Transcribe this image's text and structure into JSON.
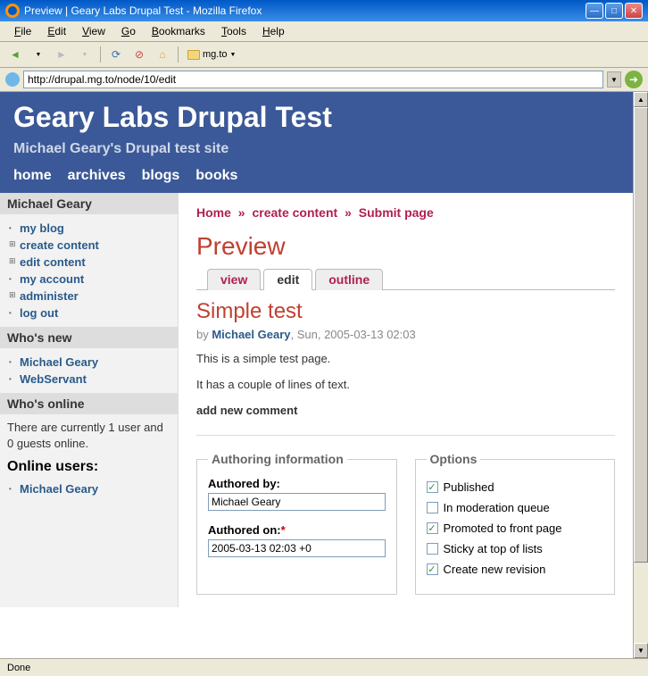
{
  "window": {
    "title": "Preview | Geary Labs Drupal Test - Mozilla Firefox"
  },
  "menubar": [
    "File",
    "Edit",
    "View",
    "Go",
    "Bookmarks",
    "Tools",
    "Help"
  ],
  "toolbar": {
    "bookmark": "mg.to"
  },
  "addressbar": {
    "url": "http://drupal.mg.to/node/10/edit"
  },
  "site": {
    "title": "Geary Labs Drupal Test",
    "tagline": "Michael Geary's Drupal test site",
    "nav": [
      "home",
      "archives",
      "blogs",
      "books"
    ]
  },
  "sidebar": {
    "user_block_title": "Michael Geary",
    "user_menu": [
      {
        "label": "my blog",
        "type": "leaf"
      },
      {
        "label": "create content",
        "type": "collapsed"
      },
      {
        "label": "edit content",
        "type": "collapsed"
      },
      {
        "label": "my account",
        "type": "leaf"
      },
      {
        "label": "administer",
        "type": "collapsed"
      },
      {
        "label": "log out",
        "type": "leaf"
      }
    ],
    "whos_new_title": "Who's new",
    "whos_new": [
      "Michael Geary",
      "WebServant"
    ],
    "whos_online_title": "Who's online",
    "whos_online_text": "There are currently 1 user and 0 guests online.",
    "online_users_heading": "Online users:",
    "online_users": [
      "Michael Geary"
    ]
  },
  "breadcrumb": [
    "Home",
    "create content",
    "Submit page"
  ],
  "page_heading": "Preview",
  "tabs": [
    {
      "label": "view",
      "active": false
    },
    {
      "label": "edit",
      "active": true
    },
    {
      "label": "outline",
      "active": false
    }
  ],
  "node": {
    "title": "Simple test",
    "by_prefix": "by ",
    "author": "Michael Geary",
    "date": ", Sun, 2005-03-13 02:03",
    "body": [
      "This is a simple test page.",
      "It has a couple of lines of text."
    ],
    "add_comment": "add new comment"
  },
  "authoring": {
    "legend": "Authoring information",
    "authored_by_label": "Authored by:",
    "authored_by_value": "Michael Geary",
    "authored_on_label": "Authored on:",
    "authored_on_value": "2005-03-13 02:03 +0"
  },
  "options": {
    "legend": "Options",
    "items": [
      {
        "label": "Published",
        "checked": true
      },
      {
        "label": "In moderation queue",
        "checked": false
      },
      {
        "label": "Promoted to front page",
        "checked": true
      },
      {
        "label": "Sticky at top of lists",
        "checked": false
      },
      {
        "label": "Create new revision",
        "checked": true
      }
    ]
  },
  "statusbar": "Done"
}
